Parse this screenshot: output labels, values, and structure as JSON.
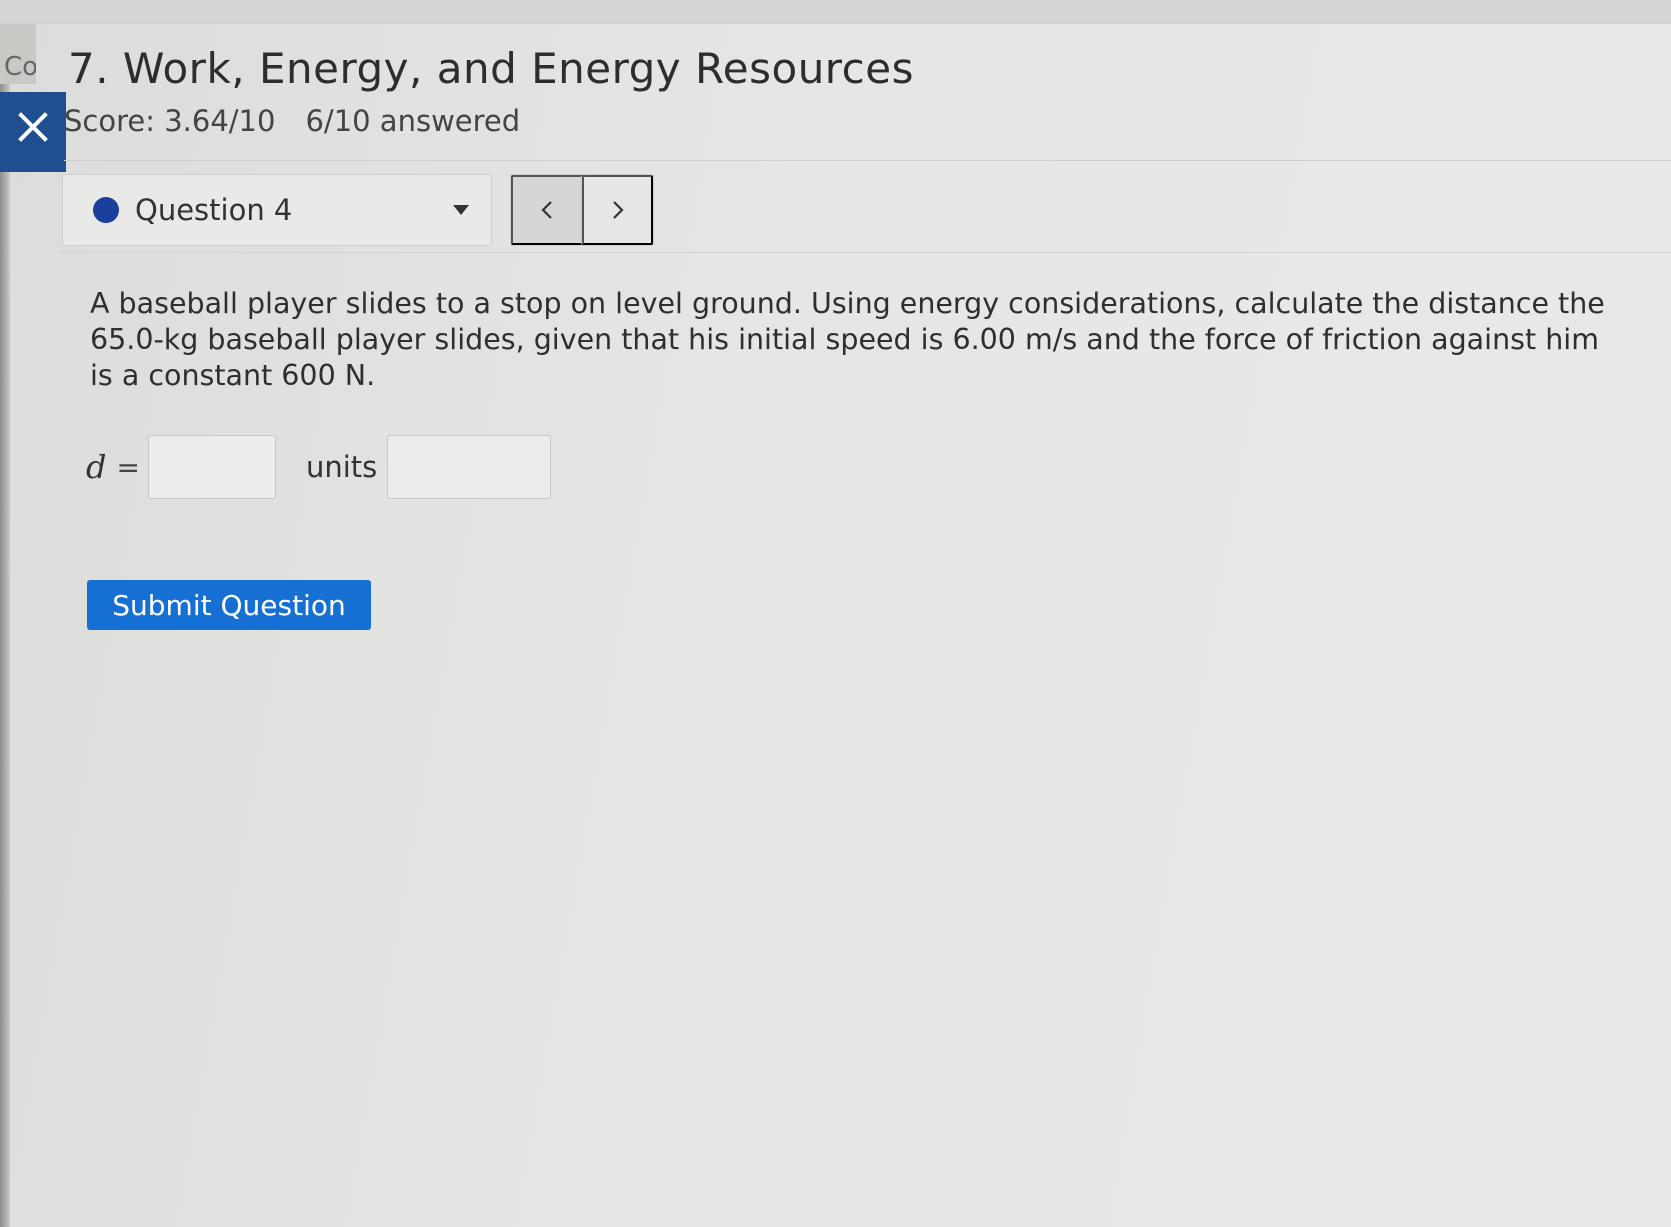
{
  "side_tab": {
    "text": "Co"
  },
  "header": {
    "title": "7. Work, Energy, and Energy Resources",
    "score": "Score: 3.64/10",
    "answered": "6/10 answered"
  },
  "question_nav": {
    "selected_question": "Question 4",
    "prev_symbol": "<",
    "next_symbol": ">"
  },
  "question": {
    "text": "A baseball player slides to a stop on level ground. Using energy considerations, calculate the distance the 65.0-kg baseball player slides, given that his initial speed is 6.00 m/s and the force of friction against him is a constant 600 N.",
    "variable": "d",
    "equals": "=",
    "answer_value": "",
    "units_label": "units",
    "units_value": ""
  },
  "actions": {
    "submit_label": "Submit Question"
  },
  "colors": {
    "accent_blue": "#1670d4",
    "close_button_blue": "#1f4f8f",
    "question_dot": "#1b3f9c"
  }
}
